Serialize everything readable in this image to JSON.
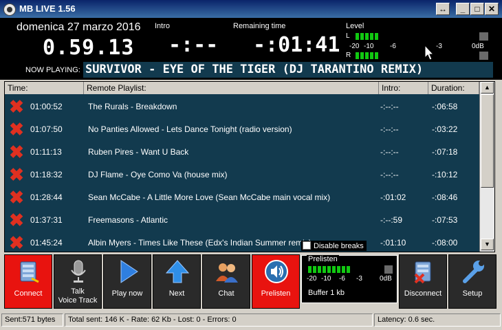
{
  "window": {
    "title": "MB LIVE   1.56",
    "btn_resize": "↔",
    "btn_min": "_",
    "btn_max": "□",
    "btn_close": "✕"
  },
  "header": {
    "date": "domenica 27 marzo 2016",
    "clock": "0.59.13",
    "intro_label": "Intro",
    "intro_value": "-:--",
    "remaining_label": "Remaining time",
    "remaining_value": "-:01:41",
    "level_label": "Level",
    "meter_l": "L",
    "meter_r": "R",
    "meter_scale": [
      "-20",
      "-10",
      "-6",
      "-3",
      "0dB"
    ],
    "now_playing_label": "NOW PLAYING:",
    "now_playing": "SURVIVOR - EYE OF THE TIGER (DJ TARANTINO REMIX)"
  },
  "playlist": {
    "columns": [
      "Time:",
      "Remote Playlist:",
      "Intro:",
      "Duration:"
    ],
    "rows": [
      {
        "time": "01:00:52",
        "title": "The Rurals - Breakdown",
        "intro": "-:--:--",
        "duration": "-:06:58"
      },
      {
        "time": "01:07:50",
        "title": "No Panties Allowed - Lets Dance Tonight (radio version)",
        "intro": "-:--:--",
        "duration": "-:03:22"
      },
      {
        "time": "01:11:13",
        "title": "Ruben Pires - Want U Back",
        "intro": "-:--:--",
        "duration": "-:07:18"
      },
      {
        "time": "01:18:32",
        "title": "DJ Flame - Oye Como Va (house mix)",
        "intro": "-:--:--",
        "duration": "-:10:12"
      },
      {
        "time": "01:28:44",
        "title": "Sean McCabe - A Little More Love (Sean McCabe main vocal mix)",
        "intro": "-:01:02",
        "duration": "-:08:46"
      },
      {
        "time": "01:37:31",
        "title": "Freemasons - Atlantic",
        "intro": "-:--:59",
        "duration": "-:07:53"
      },
      {
        "time": "01:45:24",
        "title": "Albin Myers - Times Like These (Edx's Indian Summer remix)",
        "intro": "-:01:10",
        "duration": "-:08:00"
      }
    ],
    "disable_breaks": "Disable breaks"
  },
  "toolbar": {
    "connect": "Connect",
    "talk_line1": "Talk",
    "talk_line2": "Voice Track",
    "play_now": "Play now",
    "next": "Next",
    "chat": "Chat",
    "prelisten": "Prelisten",
    "disconnect": "Disconnect",
    "setup": "Setup"
  },
  "prelisten_panel": {
    "title": "Prelisten",
    "scale": [
      "-20",
      "-10",
      "-6",
      "-3",
      "0dB"
    ],
    "buffer": "Buffer 1 kb"
  },
  "status": {
    "sent": "Sent:571 bytes",
    "totals": "Total sent: 146 K - Rate: 62 Kb - Lost: 0 - Errors: 0",
    "latency": "Latency: 0.6 sec."
  },
  "colors": {
    "accent_red": "#e8130f",
    "meter_green": "#11c911",
    "list_bg": "#123a4e"
  }
}
